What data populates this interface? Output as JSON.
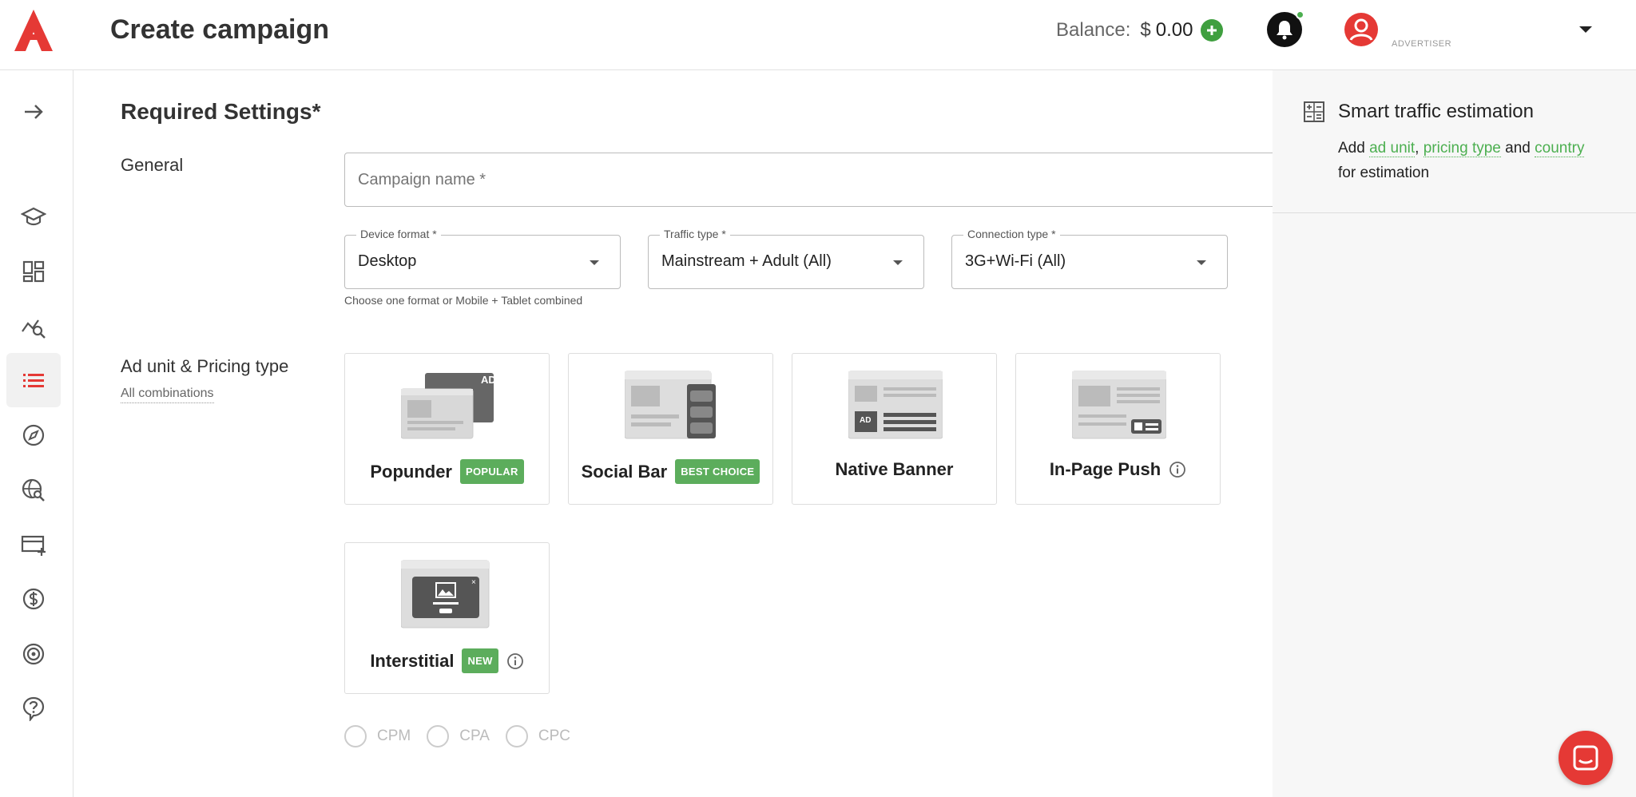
{
  "header": {
    "title": "Create campaign",
    "balance_label": "Balance:",
    "balance_currency": "$",
    "balance_amount": "0.00",
    "role": "ADVERTISER"
  },
  "sidebar": {
    "items": [
      {
        "icon": "arrow-right-icon"
      },
      {
        "icon": "graduation-cap-icon"
      },
      {
        "icon": "dashboard-icon"
      },
      {
        "icon": "statistics-icon"
      },
      {
        "icon": "campaigns-list-icon"
      },
      {
        "icon": "compass-icon"
      },
      {
        "icon": "globe-search-icon"
      },
      {
        "icon": "add-payment-icon"
      },
      {
        "icon": "dollar-icon"
      },
      {
        "icon": "target-icon"
      },
      {
        "icon": "help-icon"
      }
    ]
  },
  "form": {
    "section_title": "Required Settings*",
    "general_label": "General",
    "campaign_name_placeholder": "Campaign name *",
    "device_format": {
      "label": "Device format *",
      "value": "Desktop"
    },
    "traffic_type": {
      "label": "Traffic type *",
      "value": "Mainstream + Adult (All)"
    },
    "connection_type": {
      "label": "Connection type *",
      "value": "3G+Wi-Fi (All)"
    },
    "helper_text": "Choose one format or Mobile + Tablet combined",
    "adunit_label": "Ad unit & Pricing type",
    "all_combinations": "All combinations",
    "ad_units": [
      {
        "name": "Popunder",
        "badge": "POPULAR"
      },
      {
        "name": "Social Bar",
        "badge": "BEST CHOICE"
      },
      {
        "name": "Native Banner",
        "badge": ""
      },
      {
        "name": "In-Page Push",
        "badge": ""
      },
      {
        "name": "Interstitial",
        "badge": "NEW"
      }
    ],
    "pricing": [
      "CPM",
      "CPA",
      "CPC"
    ]
  },
  "right_panel": {
    "title": "Smart traffic estimation",
    "text_add": "Add",
    "link_ad_unit": "ad unit",
    "comma": ",",
    "link_pricing": "pricing type",
    "text_and": "and",
    "link_country": "country",
    "text_end": "for estimation"
  },
  "colors": {
    "brand": "#e53935",
    "accent_green": "#5cad5c",
    "link_green": "#4caf50"
  }
}
